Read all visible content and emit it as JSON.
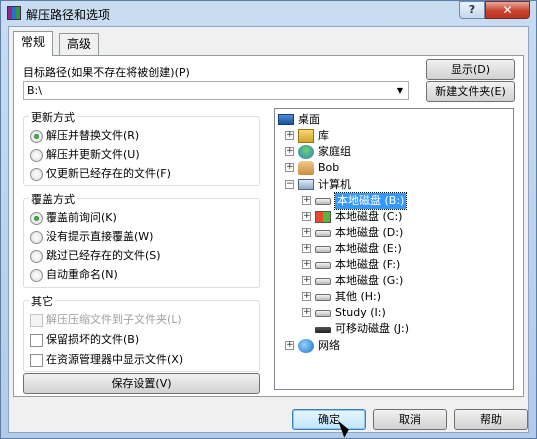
{
  "window": {
    "title": "解压路径和选项",
    "help_glyph": "?",
    "close_glyph": "✕"
  },
  "tabs": [
    {
      "label": "常规",
      "active": true
    },
    {
      "label": "高级",
      "active": false
    }
  ],
  "target": {
    "label": "目标路径(如果不存在将被创建)(P)",
    "value": "B:\\",
    "arrow": "▼",
    "show_button": "显示(D)",
    "new_folder_button": "新建文件夹(E)"
  },
  "update_mode": {
    "title": "更新方式",
    "options": [
      {
        "label": "解压并替换文件(R)",
        "selected": true
      },
      {
        "label": "解压并更新文件(U)",
        "selected": false
      },
      {
        "label": "仅更新已经存在的文件(F)",
        "selected": false
      }
    ]
  },
  "overwrite_mode": {
    "title": "覆盖方式",
    "options": [
      {
        "label": "覆盖前询问(K)",
        "selected": true
      },
      {
        "label": "没有提示直接覆盖(W)",
        "selected": false
      },
      {
        "label": "跳过已经存在的文件(S)",
        "selected": false
      },
      {
        "label": "自动重命名(N)",
        "selected": false
      }
    ]
  },
  "misc": {
    "title": "其它",
    "options": [
      {
        "label": "解压压缩文件到子文件夹(L)",
        "checked": false,
        "disabled": true
      },
      {
        "label": "保留损坏的文件(B)",
        "checked": false,
        "disabled": false
      },
      {
        "label": "在资源管理器中显示文件(X)",
        "checked": false,
        "disabled": false
      }
    ]
  },
  "save_button": "保存设置(V)",
  "tree": [
    {
      "label": "桌面",
      "icon": "desktop-icon",
      "expander": ""
    },
    {
      "label": "库",
      "icon": "library-icon",
      "expander": "+"
    },
    {
      "label": "家庭组",
      "icon": "homegroup-icon",
      "expander": "+"
    },
    {
      "label": "Bob",
      "icon": "user-icon",
      "expander": "+"
    },
    {
      "label": "计算机",
      "icon": "computer-icon",
      "expander": "−"
    },
    {
      "label": "本地磁盘 (B:)",
      "icon": "drive-icon",
      "expander": "+",
      "selected": true
    },
    {
      "label": "本地磁盘 (C:)",
      "icon": "system-drive-icon",
      "expander": "+"
    },
    {
      "label": "本地磁盘 (D:)",
      "icon": "drive-icon",
      "expander": "+"
    },
    {
      "label": "本地磁盘 (E:)",
      "icon": "drive-icon",
      "expander": "+"
    },
    {
      "label": "本地磁盘 (F:)",
      "icon": "drive-icon",
      "expander": "+"
    },
    {
      "label": "本地磁盘 (G:)",
      "icon": "drive-icon",
      "expander": "+"
    },
    {
      "label": "其他 (H:)",
      "icon": "drive-icon",
      "expander": "+"
    },
    {
      "label": "Study (I:)",
      "icon": "drive-icon",
      "expander": "+"
    },
    {
      "label": "可移动磁盘 (J:)",
      "icon": "removable-drive-icon",
      "expander": ""
    },
    {
      "label": "网络",
      "icon": "network-icon",
      "expander": "+"
    }
  ],
  "footer": {
    "ok": "确定",
    "cancel": "取消",
    "help": "帮助"
  }
}
